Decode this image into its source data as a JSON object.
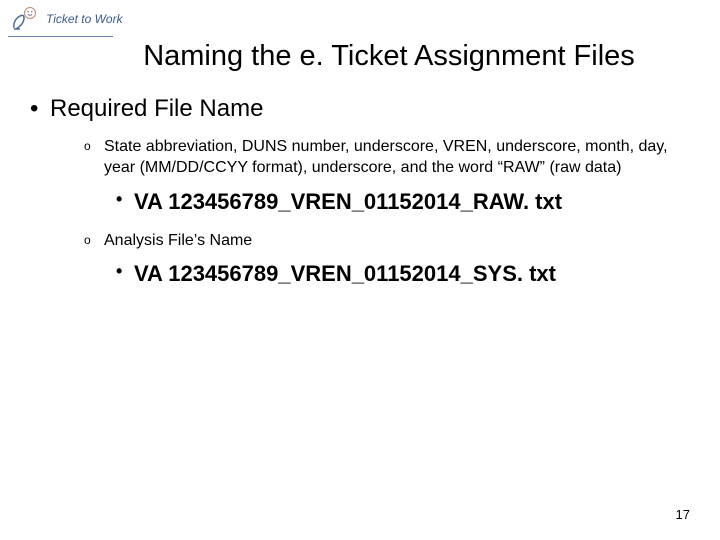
{
  "logo": {
    "line1": "Ticket to Work"
  },
  "title": "Naming the e. Ticket Assignment Files",
  "bullet1": "Required File Name",
  "sub1": "State abbreviation, DUNS number, underscore, VREN, underscore, month, day, year (MM/DD/CCYY format), underscore, and the word “RAW” (raw data)",
  "example1": "VA 123456789_VREN_01152014_RAW. txt",
  "sub2": "Analysis File’s Name",
  "example2": "VA 123456789_VREN_01152014_SYS. txt",
  "pageNumber": "17"
}
